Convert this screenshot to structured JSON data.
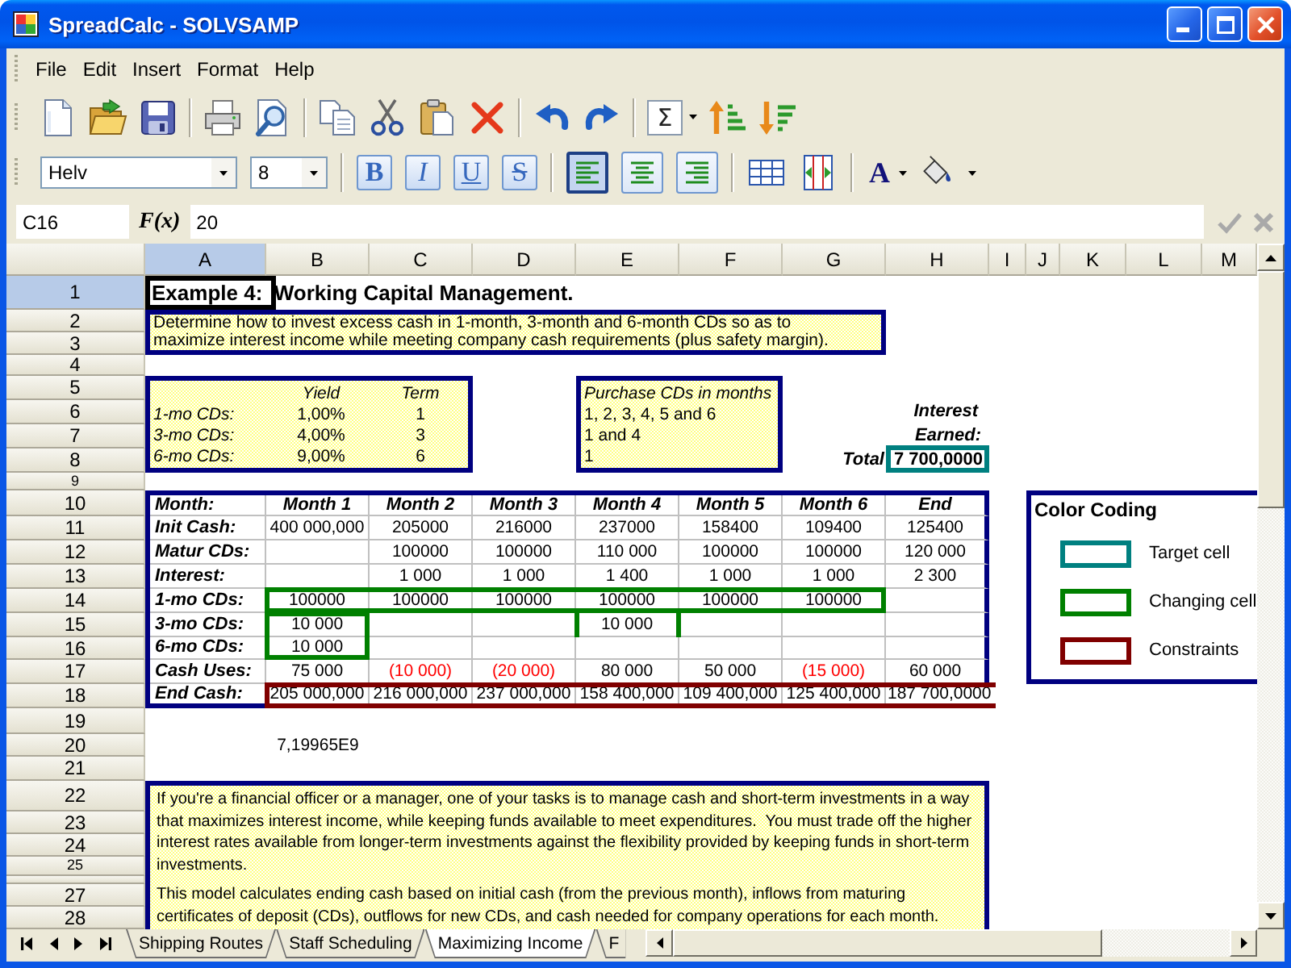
{
  "window": {
    "title": "SpreadCalc - SOLVSAMP"
  },
  "menu": [
    {
      "label": "File"
    },
    {
      "label": "Edit"
    },
    {
      "label": "Insert"
    },
    {
      "label": "Format"
    },
    {
      "label": "Help"
    }
  ],
  "standard_toolbar": {
    "sum_label": "Σ"
  },
  "format_toolbar": {
    "font": "Helv",
    "size": "8",
    "style_buttons": [
      {
        "kind": "bold",
        "label": "B",
        "pressed": false
      },
      {
        "kind": "italic",
        "label": "I",
        "pressed": false
      },
      {
        "kind": "underline",
        "label": "U",
        "pressed": false
      },
      {
        "kind": "strikethrough",
        "label": "S",
        "pressed": false
      }
    ],
    "align_buttons": [
      {
        "kind": "left",
        "selected": true
      },
      {
        "kind": "center",
        "selected": false
      },
      {
        "kind": "right",
        "selected": false
      }
    ],
    "font_color_label": "A"
  },
  "formula_bar": {
    "cell": "C16",
    "fx_label": "F(x)",
    "value": "20"
  },
  "columns": [
    {
      "label": "A",
      "selected": true
    },
    {
      "label": "B",
      "selected": false
    },
    {
      "label": "C",
      "selected": false
    },
    {
      "label": "D",
      "selected": false
    },
    {
      "label": "E",
      "selected": false
    },
    {
      "label": "F",
      "selected": false
    },
    {
      "label": "G",
      "selected": false
    },
    {
      "label": "H",
      "selected": false
    },
    {
      "label": "I",
      "selected": false
    },
    {
      "label": "J",
      "selected": false
    },
    {
      "label": "K",
      "selected": false
    },
    {
      "label": "L",
      "selected": false
    },
    {
      "label": "M",
      "selected": false
    }
  ],
  "rows": [
    {
      "label": "1",
      "selected": true
    },
    {
      "label": "2",
      "selected": false
    },
    {
      "label": "3",
      "selected": false
    },
    {
      "label": "4",
      "selected": false
    },
    {
      "label": "5",
      "selected": false
    },
    {
      "label": "6",
      "selected": false
    },
    {
      "label": "7",
      "selected": false
    },
    {
      "label": "8",
      "selected": false
    },
    {
      "label": "9",
      "selected": false
    },
    {
      "label": "10",
      "selected": false
    },
    {
      "label": "11",
      "selected": false
    },
    {
      "label": "12",
      "selected": false
    },
    {
      "label": "13",
      "selected": false
    },
    {
      "label": "14",
      "selected": false
    },
    {
      "label": "15",
      "selected": false
    },
    {
      "label": "16",
      "selected": false
    },
    {
      "label": "17",
      "selected": false
    },
    {
      "label": "18",
      "selected": false
    },
    {
      "label": "19",
      "selected": false
    },
    {
      "label": "20",
      "selected": false
    },
    {
      "label": "21",
      "selected": false
    },
    {
      "label": "22",
      "selected": false
    },
    {
      "label": "23",
      "selected": false
    },
    {
      "label": "24",
      "selected": false
    },
    {
      "label": "25",
      "selected": false
    },
    {
      "selected": false
    },
    {
      "label": "27",
      "selected": false
    },
    {
      "label": "28",
      "selected": false
    }
  ],
  "sheet": {
    "title": "Example 4:  Working Capital Management.",
    "intro": [
      "Determine how to invest excess cash in 1-month, 3-month and 6-month CDs so as to",
      "maximize interest income while meeting company cash requirements (plus safety margin)."
    ],
    "cd_rates": {
      "headers": [
        "Yield",
        "Term"
      ],
      "rows": [
        {
          "label": "1-mo CDs:",
          "yield": "1,00%",
          "term": "1"
        },
        {
          "label": "3-mo CDs:",
          "yield": "4,00%",
          "term": "3"
        },
        {
          "label": "6-mo CDs:",
          "yield": "9,00%",
          "term": "6"
        }
      ]
    },
    "purchase_months": {
      "heading": "Purchase CDs in months",
      "rows": [
        "1, 2, 3, 4, 5 and 6",
        "1 and 4",
        "1"
      ]
    },
    "interest_earned": {
      "label_lines": [
        "Interest",
        "Earned:"
      ],
      "total_label": "Total",
      "total": "7 700,0000"
    },
    "cash_table": {
      "header": [
        "Month:",
        "Month 1",
        "Month 2",
        "Month 3",
        "Month 4",
        "Month 5",
        "Month 6",
        "End"
      ],
      "rows": [
        {
          "label": "Init Cash:",
          "cells": [
            {
              "text": "400 000,000",
              "negative": false
            },
            {
              "text": "205000",
              "negative": false
            },
            {
              "text": "216000",
              "negative": false
            },
            {
              "text": "237000",
              "negative": false
            },
            {
              "text": "158400",
              "negative": false
            },
            {
              "text": "109400",
              "negative": false
            },
            {
              "text": "125400",
              "negative": false
            }
          ]
        },
        {
          "label": "Matur CDs:",
          "cells": [
            null,
            {
              "text": "100000",
              "negative": false
            },
            {
              "text": "100000",
              "negative": false
            },
            {
              "text": "110 000",
              "negative": false
            },
            {
              "text": "100000",
              "negative": false
            },
            {
              "text": "100000",
              "negative": false
            },
            {
              "text": "120 000",
              "negative": false
            }
          ]
        },
        {
          "label": "Interest:",
          "cells": [
            null,
            {
              "text": "1 000",
              "negative": false
            },
            {
              "text": "1 000",
              "negative": false
            },
            {
              "text": "1 400",
              "negative": false
            },
            {
              "text": "1 000",
              "negative": false
            },
            {
              "text": "1 000",
              "negative": false
            },
            {
              "text": "2 300",
              "negative": false
            }
          ]
        },
        {
          "label": "1-mo CDs:",
          "cells": [
            {
              "text": "100000",
              "negative": false
            },
            {
              "text": "100000",
              "negative": false
            },
            {
              "text": "100000",
              "negative": false
            },
            {
              "text": "100000",
              "negative": false
            },
            {
              "text": "100000",
              "negative": false
            },
            {
              "text": "100000",
              "negative": false
            },
            null
          ]
        },
        {
          "label": "3-mo CDs:",
          "cells": [
            {
              "text": "10 000",
              "negative": false
            },
            null,
            null,
            {
              "text": "10 000",
              "negative": false
            },
            null,
            null,
            null
          ]
        },
        {
          "label": "6-mo CDs:",
          "cells": [
            {
              "text": "10 000",
              "negative": false
            },
            null,
            null,
            null,
            null,
            null,
            null
          ]
        },
        {
          "label": "Cash Uses:",
          "cells": [
            {
              "text": "75 000",
              "negative": false
            },
            {
              "text": "(10 000)",
              "negative": true
            },
            {
              "text": "(20 000)",
              "negative": true
            },
            {
              "text": "80 000",
              "negative": false
            },
            {
              "text": "50 000",
              "negative": false
            },
            {
              "text": "(15 000)",
              "negative": true
            },
            {
              "text": "60 000",
              "negative": false
            }
          ]
        },
        {
          "label": "End Cash:",
          "cells": [
            {
              "text": "205 000,000",
              "negative": false
            },
            {
              "text": "216 000,000",
              "negative": false
            },
            {
              "text": "237 000,000",
              "negative": false
            },
            {
              "text": "158 400,000",
              "negative": false
            },
            {
              "text": "109 400,000",
              "negative": false
            },
            {
              "text": "125 400,000",
              "negative": false
            },
            {
              "text": "187 700,0000",
              "negative": false
            }
          ]
        }
      ]
    },
    "result": "7,19965E9",
    "color_coding": {
      "title": "Color Coding",
      "items": [
        {
          "label": "Target cell",
          "color": "#008080"
        },
        {
          "label": "Changing cell",
          "color": "#008000"
        },
        {
          "label": "Constraints",
          "color": "#800000"
        }
      ]
    },
    "description": [
      "If you're a financial officer or a manager, one of your tasks is to manage cash and short-term investments in a way that maximizes interest income, while keeping funds available to meet expenditures.  You must trade off the higher interest rates available from longer-term investments against the flexibility provided by keeping funds in short-term investments.",
      "This model calculates ending cash based on initial cash (from the previous month), inflows from maturing certificates of deposit (CDs), outflows for new CDs, and cash needed for company operations for each month."
    ]
  },
  "sheet_tabs": [
    {
      "label": "Shipping Routes",
      "selected": false
    },
    {
      "label": "Staff Scheduling",
      "selected": false
    },
    {
      "label": "Maximizing Income",
      "selected": true
    },
    {
      "label": "F",
      "selected": false
    }
  ]
}
